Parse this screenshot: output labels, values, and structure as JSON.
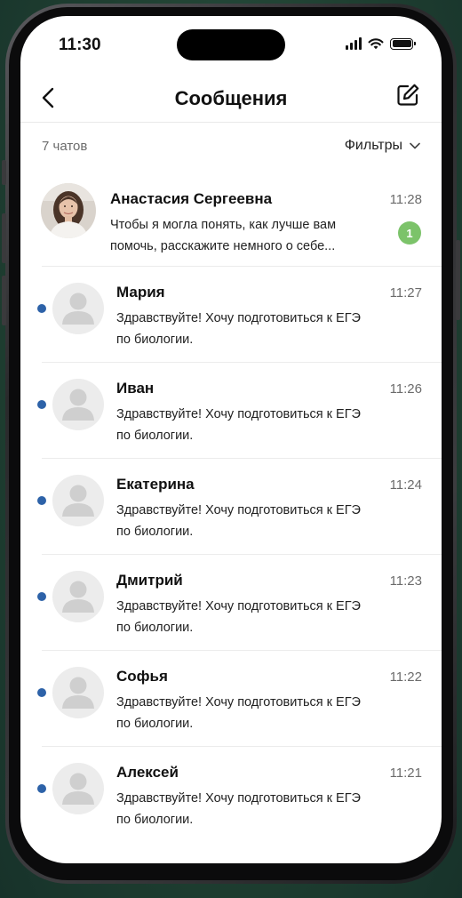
{
  "status_bar": {
    "time": "11:30"
  },
  "header": {
    "title": "Сообщения"
  },
  "subbar": {
    "count": "7 чатов",
    "filters_label": "Фильтры"
  },
  "colors": {
    "accent_dot": "#2d62a8",
    "badge": "#7cc36a"
  },
  "chats": [
    {
      "name": "Анастасия Сергеевна",
      "time": "11:28",
      "line1": "Чтобы я могла понять, как лучше вам",
      "line2": "помочь, расскажите немного о себе...",
      "badge": "1",
      "avatar": "photo"
    },
    {
      "name": "Мария",
      "time": "11:27",
      "line1": "Здравствуйте! Хочу подготовиться к ЕГЭ",
      "line2": "по биологии.",
      "unread": true,
      "avatar": "placeholder"
    },
    {
      "name": "Иван",
      "time": "11:26",
      "line1": "Здравствуйте! Хочу подготовиться к ЕГЭ",
      "line2": "по биологии.",
      "unread": true,
      "avatar": "placeholder"
    },
    {
      "name": "Екатерина",
      "time": "11:24",
      "line1": "Здравствуйте! Хочу подготовиться к ЕГЭ",
      "line2": "по биологии.",
      "unread": true,
      "avatar": "placeholder"
    },
    {
      "name": "Дмитрий",
      "time": "11:23",
      "line1": "Здравствуйте! Хочу подготовиться к ЕГЭ",
      "line2": "по биологии.",
      "unread": true,
      "avatar": "placeholder"
    },
    {
      "name": "Софья",
      "time": "11:22",
      "line1": "Здравствуйте! Хочу подготовиться к ЕГЭ",
      "line2": "по биологии.",
      "unread": true,
      "avatar": "placeholder"
    },
    {
      "name": "Алексей",
      "time": "11:21",
      "line1": "Здравствуйте! Хочу подготовиться к ЕГЭ",
      "line2": "по биологии.",
      "unread": true,
      "avatar": "placeholder"
    }
  ]
}
